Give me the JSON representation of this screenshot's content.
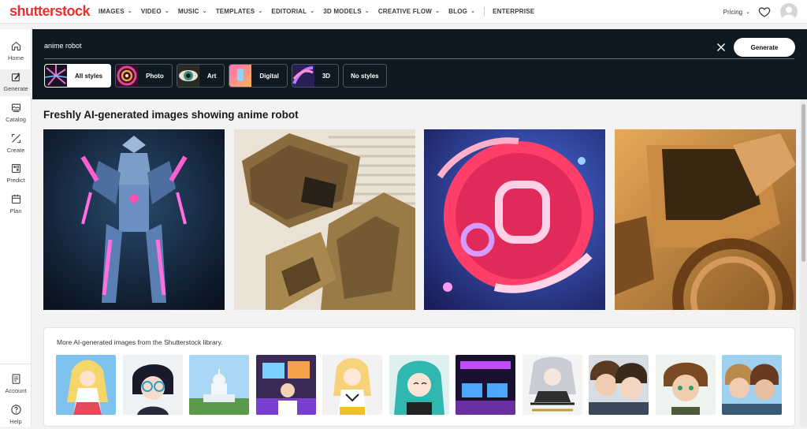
{
  "brand": {
    "logo_text": "shutterstock",
    "accent": "#e8302e"
  },
  "nav": {
    "items": [
      {
        "label": "IMAGES",
        "dropdown": true
      },
      {
        "label": "VIDEO",
        "dropdown": true
      },
      {
        "label": "MUSIC",
        "dropdown": true
      },
      {
        "label": "TEMPLATES",
        "dropdown": true
      },
      {
        "label": "EDITORIAL",
        "dropdown": true
      },
      {
        "label": "3D MODELS",
        "dropdown": true
      },
      {
        "label": "CREATIVE FLOW",
        "dropdown": true
      },
      {
        "label": "BLOG",
        "dropdown": true
      },
      {
        "label": "ENTERPRISE",
        "dropdown": false
      }
    ],
    "pricing_label": "Pricing",
    "favorites_icon": "heart-icon",
    "avatar_icon": "user-avatar-icon"
  },
  "sidebar": {
    "items": [
      {
        "label": "Home",
        "icon": "home-icon"
      },
      {
        "label": "Generate",
        "icon": "generate-icon",
        "active": true
      },
      {
        "label": "Catalog",
        "icon": "catalog-icon"
      },
      {
        "label": "Create",
        "icon": "create-icon"
      },
      {
        "label": "Predict",
        "icon": "predict-icon"
      },
      {
        "label": "Plan",
        "icon": "plan-icon"
      }
    ],
    "bottom": [
      {
        "label": "Account",
        "icon": "account-icon"
      },
      {
        "label": "Help",
        "icon": "help-icon"
      }
    ]
  },
  "generator": {
    "prompt_value": "anime robot",
    "clear_icon": "close-icon",
    "generate_label": "Generate",
    "styles": [
      {
        "label": "All styles",
        "active": true
      },
      {
        "label": "Photo",
        "active": false
      },
      {
        "label": "Art",
        "active": false
      },
      {
        "label": "Digital",
        "active": false
      },
      {
        "label": "3D",
        "active": false
      },
      {
        "label": "No styles",
        "active": false
      }
    ],
    "background": "#0e1a22"
  },
  "results": {
    "title": "Freshly AI-generated images showing anime robot"
  },
  "library": {
    "title": "More AI-generated images from the Shutterstock library."
  }
}
